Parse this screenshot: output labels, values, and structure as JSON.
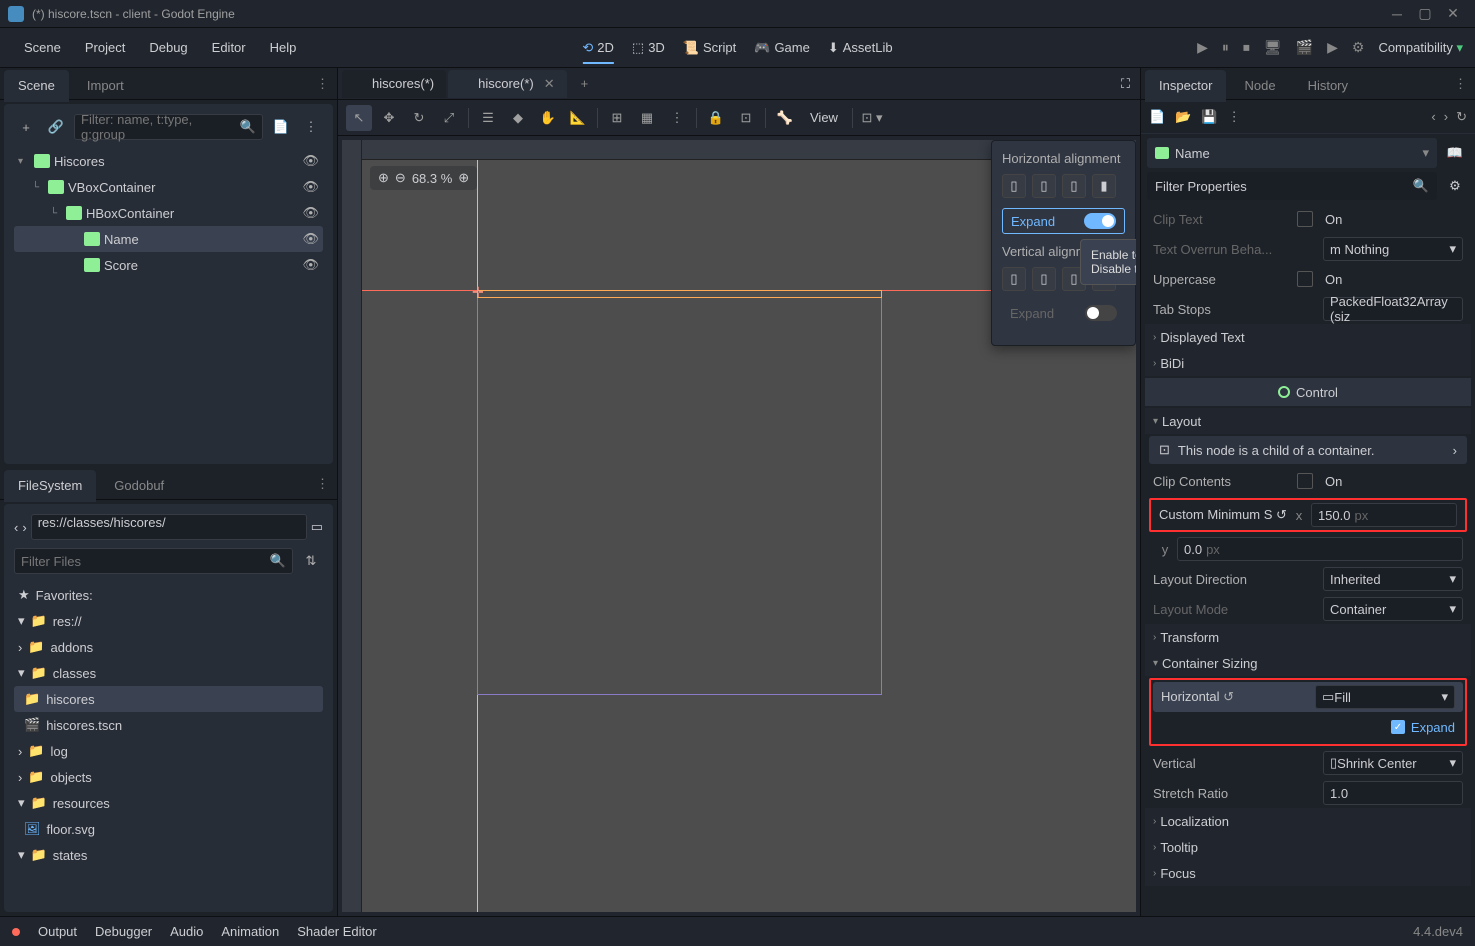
{
  "window": {
    "title": "(*) hiscore.tscn - client - Godot Engine"
  },
  "menu": {
    "scene": "Scene",
    "project": "Project",
    "debug": "Debug",
    "editor": "Editor",
    "help": "Help"
  },
  "modes": {
    "d2": "2D",
    "d3": "3D",
    "script": "Script",
    "game": "Game",
    "assetlib": "AssetLib"
  },
  "playbar": {
    "compatibility": "Compatibility"
  },
  "scene_panel": {
    "tabs": {
      "scene": "Scene",
      "import": "Import"
    },
    "filter_placeholder": "Filter: name, t:type, g:group",
    "tree": [
      {
        "label": "Hiscores",
        "indent": 0,
        "collapsed": false
      },
      {
        "label": "VBoxContainer",
        "indent": 1,
        "collapsed": false
      },
      {
        "label": "HBoxContainer",
        "indent": 2,
        "collapsed": false
      },
      {
        "label": "Name",
        "indent": 3,
        "selected": true
      },
      {
        "label": "Score",
        "indent": 3
      }
    ]
  },
  "fs_panel": {
    "tabs": {
      "fs": "FileSystem",
      "godobuf": "Godobuf"
    },
    "path": "res://classes/hiscores/",
    "filter_placeholder": "Filter Files",
    "favorites": "Favorites:",
    "tree": [
      {
        "label": "res://",
        "indent": 0,
        "open": true
      },
      {
        "label": "addons",
        "indent": 1
      },
      {
        "label": "classes",
        "indent": 1,
        "open": true
      },
      {
        "label": "hiscores",
        "indent": 2,
        "selected": true
      },
      {
        "label": "hiscores.tscn",
        "indent": 3,
        "file": true
      },
      {
        "label": "log",
        "indent": 1
      },
      {
        "label": "objects",
        "indent": 1
      },
      {
        "label": "resources",
        "indent": 1,
        "open": true
      },
      {
        "label": "floor.svg",
        "indent": 2,
        "file": true
      },
      {
        "label": "states",
        "indent": 1
      }
    ]
  },
  "docs": {
    "tab1": "hiscores(*)",
    "tab2": "hiscore(*)"
  },
  "canvas": {
    "zoom": "68.3 %",
    "view": "View"
  },
  "popup": {
    "h_align": "Horizontal alignment",
    "v_align": "Vertical alignment",
    "expand": "Expand",
    "tooltip": "Enable to also set the Expand flag. Disable to only set Shrink/Fill flags."
  },
  "inspector": {
    "tabs": {
      "inspector": "Inspector",
      "node": "Node",
      "history": "History"
    },
    "node_name": "Name",
    "filter_placeholder": "Filter Properties",
    "clip_text": {
      "label": "Clip Text",
      "value": "On"
    },
    "text_overrun": {
      "label": "Text Overrun Behavior",
      "value": "m Nothing"
    },
    "uppercase": {
      "label": "Uppercase",
      "value": "On"
    },
    "tab_stops": {
      "label": "Tab Stops",
      "value": "PackedFloat32Array (siz"
    },
    "displayed_text": "Displayed Text",
    "bidi": "BiDi",
    "control": "Control",
    "layout": "Layout",
    "child_hint": "This node is a child of a container.",
    "clip_contents": {
      "label": "Clip Contents",
      "value": "On"
    },
    "custom_min": {
      "label": "Custom Minimum S",
      "x": "150.0",
      "y": "0.0",
      "unit": "px"
    },
    "layout_dir": {
      "label": "Layout Direction",
      "value": "Inherited"
    },
    "layout_mode": {
      "label": "Layout Mode",
      "value": "Container"
    },
    "transform": "Transform",
    "container_sizing": "Container Sizing",
    "horizontal": {
      "label": "Horizontal",
      "value": "Fill",
      "expand": "Expand"
    },
    "vertical": {
      "label": "Vertical",
      "value": "Shrink Center"
    },
    "stretch": {
      "label": "Stretch Ratio",
      "value": "1.0"
    },
    "localization": "Localization",
    "tooltip": "Tooltip",
    "focus": "Focus"
  },
  "bottom": {
    "output": "Output",
    "debugger": "Debugger",
    "audio": "Audio",
    "animation": "Animation",
    "shader": "Shader Editor",
    "version": "4.4.dev4"
  }
}
